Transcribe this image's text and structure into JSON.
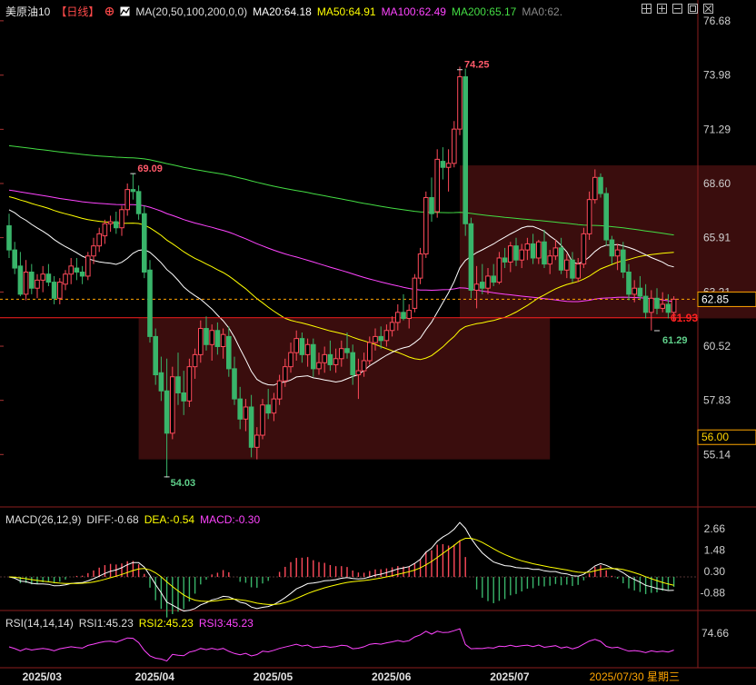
{
  "header": {
    "symbol": "美原油10",
    "period": "【日线】",
    "ma_title": "MA(20,50,100,200,0,0)",
    "ma20": "MA20:64.18",
    "ma50": "MA50:64.91",
    "ma100": "MA100:62.49",
    "ma200": "MA200:65.17",
    "ma0": "MA0:62.",
    "colors": {
      "ma20": "#ffffff",
      "ma50": "#ffff00",
      "ma100": "#ff44ff",
      "ma200": "#44dd44",
      "ma0": "#888888"
    }
  },
  "macd_header": {
    "title": "MACD(26,12,9)",
    "diff": "DIFF:-0.68",
    "dea": "DEA:-0.54",
    "macd": "MACD:-0.30"
  },
  "rsi_header": {
    "title": "RSI(14,14,14)",
    "rsi1": "RSI1:45.23",
    "rsi2": "RSI2:45.23",
    "rsi3": "RSI3:45.23"
  },
  "price_badges": {
    "current": "62.85",
    "ref_level": "56.00",
    "last": "61.93"
  },
  "annotations": {
    "high1": "69.09",
    "low1": "54.03",
    "high2": "74.25",
    "low2": "61.29"
  },
  "date_footer": "2025/07/30 星期三",
  "chart_data": [
    {
      "type": "candlestick",
      "ylim": [
        53.8,
        76.9
      ],
      "y_ticks": [
        "76.68",
        "73.98",
        "71.29",
        "68.60",
        "65.91",
        "63.21",
        "60.52",
        "57.83",
        "55.14"
      ],
      "x_ticks": [
        "2025/03",
        "2025/04",
        "2025/05",
        "2025/06",
        "2025/07"
      ],
      "reference_lines": {
        "current": 62.85,
        "last_close_line": 61.93
      },
      "boxes": [
        {
          "from_index": 23,
          "to_index": 96,
          "low": 54.9,
          "high": 61.9,
          "color": "#8b1e1e"
        },
        {
          "from_index": 80,
          "to_index": 146,
          "low": 61.9,
          "high": 69.5,
          "color": "#8b1e1e"
        }
      ],
      "ohlc": [
        [
          66.5,
          67.1,
          64.9,
          65.3
        ],
        [
          65.3,
          65.7,
          64.1,
          64.4
        ],
        [
          64.5,
          65.2,
          63.0,
          63.1
        ],
        [
          63.1,
          64.8,
          62.8,
          64.2
        ],
        [
          64.2,
          64.6,
          63.1,
          63.4
        ],
        [
          63.4,
          64.1,
          62.9,
          63.8
        ],
        [
          63.8,
          64.5,
          63.2,
          64.1
        ],
        [
          64.1,
          64.6,
          63.5,
          63.7
        ],
        [
          63.7,
          64.0,
          62.6,
          62.9
        ],
        [
          62.9,
          63.9,
          62.6,
          63.7
        ],
        [
          63.6,
          64.3,
          63.3,
          64.1
        ],
        [
          64.1,
          64.9,
          63.6,
          64.5
        ],
        [
          64.4,
          64.9,
          63.8,
          64.2
        ],
        [
          64.2,
          64.5,
          63.6,
          64.0
        ],
        [
          64.0,
          65.2,
          63.8,
          65.0
        ],
        [
          65.0,
          65.9,
          64.6,
          65.5
        ],
        [
          65.5,
          66.4,
          65.2,
          66.1
        ],
        [
          66.0,
          66.8,
          65.6,
          66.6
        ],
        [
          66.6,
          67.0,
          66.2,
          66.7
        ],
        [
          66.7,
          67.2,
          66.1,
          66.4
        ],
        [
          66.4,
          67.5,
          66.0,
          67.3
        ],
        [
          67.3,
          68.6,
          67.0,
          68.3
        ],
        [
          68.3,
          69.1,
          67.8,
          68.2
        ],
        [
          68.2,
          68.5,
          66.8,
          67.1
        ],
        [
          67.1,
          67.5,
          63.9,
          64.2
        ],
        [
          64.3,
          64.8,
          60.7,
          61.0
        ],
        [
          61.0,
          61.4,
          58.6,
          59.1
        ],
        [
          59.2,
          60.0,
          57.8,
          58.3
        ],
        [
          58.3,
          59.9,
          54.0,
          56.2
        ],
        [
          56.2,
          59.5,
          55.9,
          59.0
        ],
        [
          59.0,
          60.2,
          57.6,
          58.2
        ],
        [
          58.2,
          59.3,
          57.1,
          57.8
        ],
        [
          57.8,
          59.9,
          57.5,
          59.5
        ],
        [
          59.5,
          60.4,
          58.9,
          60.1
        ],
        [
          60.1,
          61.8,
          59.7,
          61.4
        ],
        [
          61.4,
          62.0,
          60.3,
          60.6
        ],
        [
          60.6,
          61.6,
          59.8,
          61.3
        ],
        [
          61.3,
          61.7,
          60.1,
          60.5
        ],
        [
          60.5,
          61.4,
          59.9,
          61.1
        ],
        [
          61.0,
          61.5,
          59.0,
          59.4
        ],
        [
          59.4,
          60.0,
          57.6,
          57.9
        ],
        [
          57.9,
          58.5,
          56.4,
          56.9
        ],
        [
          56.9,
          57.9,
          56.3,
          57.5
        ],
        [
          57.5,
          58.1,
          55.0,
          55.5
        ],
        [
          55.5,
          56.5,
          54.9,
          56.1
        ],
        [
          56.1,
          57.9,
          55.9,
          57.6
        ],
        [
          57.6,
          58.4,
          56.9,
          57.2
        ],
        [
          57.2,
          58.2,
          56.8,
          57.9
        ],
        [
          57.9,
          59.1,
          57.6,
          58.8
        ],
        [
          58.8,
          59.9,
          58.5,
          59.5
        ],
        [
          59.5,
          60.7,
          59.2,
          60.2
        ],
        [
          60.2,
          61.3,
          59.8,
          60.9
        ],
        [
          60.9,
          61.2,
          59.7,
          60.1
        ],
        [
          60.1,
          60.9,
          59.5,
          60.6
        ],
        [
          60.6,
          60.9,
          59.0,
          59.4
        ],
        [
          59.4,
          60.2,
          59.1,
          59.7
        ],
        [
          59.7,
          60.5,
          59.2,
          60.1
        ],
        [
          60.1,
          60.8,
          59.3,
          59.6
        ],
        [
          59.6,
          60.4,
          59.2,
          59.9
        ],
        [
          59.9,
          60.8,
          59.5,
          60.4
        ],
        [
          60.4,
          61.2,
          59.9,
          60.2
        ],
        [
          60.2,
          60.6,
          58.6,
          59.1
        ],
        [
          59.1,
          59.9,
          57.9,
          59.3
        ],
        [
          59.3,
          60.2,
          59.0,
          59.8
        ],
        [
          59.8,
          61.0,
          59.6,
          60.7
        ],
        [
          60.7,
          61.4,
          60.3,
          61.0
        ],
        [
          61.0,
          61.5,
          60.4,
          60.8
        ],
        [
          60.8,
          61.6,
          60.5,
          61.3
        ],
        [
          61.3,
          62.0,
          61.0,
          61.7
        ],
        [
          61.7,
          62.6,
          61.3,
          62.2
        ],
        [
          62.2,
          63.1,
          61.8,
          61.9
        ],
        [
          61.9,
          62.6,
          61.4,
          62.3
        ],
        [
          62.4,
          64.1,
          62.2,
          63.9
        ],
        [
          63.9,
          65.4,
          63.6,
          65.1
        ],
        [
          65.1,
          68.2,
          64.9,
          67.9
        ],
        [
          67.9,
          68.9,
          66.7,
          67.1
        ],
        [
          67.2,
          70.3,
          66.9,
          69.8
        ],
        [
          69.7,
          70.4,
          68.8,
          69.4
        ],
        [
          69.4,
          70.3,
          68.2,
          69.6
        ],
        [
          69.6,
          71.7,
          69.4,
          71.3
        ],
        [
          71.3,
          74.4,
          71.0,
          73.9
        ],
        [
          73.9,
          74.3,
          66.0,
          66.6
        ],
        [
          66.6,
          66.9,
          62.9,
          63.3
        ],
        [
          63.3,
          64.5,
          62.4,
          63.6
        ],
        [
          63.7,
          64.6,
          63.1,
          63.4
        ],
        [
          63.4,
          64.4,
          63.1,
          64.0
        ],
        [
          64.0,
          64.6,
          63.5,
          63.7
        ],
        [
          63.7,
          65.2,
          63.6,
          64.9
        ],
        [
          64.9,
          65.4,
          64.4,
          64.7
        ],
        [
          64.7,
          65.7,
          64.2,
          65.5
        ],
        [
          65.5,
          65.9,
          64.5,
          64.8
        ],
        [
          64.8,
          65.6,
          64.4,
          65.3
        ],
        [
          65.3,
          65.9,
          64.8,
          65.6
        ],
        [
          65.6,
          66.1,
          64.6,
          64.9
        ],
        [
          64.9,
          65.8,
          64.6,
          65.7
        ],
        [
          65.7,
          66.3,
          64.4,
          64.6
        ],
        [
          64.6,
          65.3,
          64.1,
          65.0
        ],
        [
          65.0,
          65.8,
          64.8,
          65.4
        ],
        [
          65.4,
          65.9,
          64.1,
          64.3
        ],
        [
          64.3,
          65.1,
          63.9,
          64.8
        ],
        [
          64.8,
          65.2,
          63.7,
          63.9
        ],
        [
          63.9,
          64.9,
          63.7,
          64.6
        ],
        [
          64.6,
          66.4,
          64.4,
          66.1
        ],
        [
          66.1,
          68.2,
          65.8,
          67.8
        ],
        [
          67.8,
          69.3,
          67.6,
          68.9
        ],
        [
          68.9,
          69.1,
          67.9,
          68.1
        ],
        [
          68.1,
          68.4,
          65.5,
          65.8
        ],
        [
          65.8,
          66.0,
          64.6,
          65.0
        ],
        [
          65.0,
          65.6,
          64.3,
          65.3
        ],
        [
          65.3,
          65.7,
          63.9,
          64.2
        ],
        [
          64.2,
          64.6,
          62.8,
          63.1
        ],
        [
          63.1,
          63.8,
          62.7,
          63.4
        ],
        [
          63.4,
          64.0,
          62.8,
          63.0
        ],
        [
          63.0,
          63.6,
          61.9,
          62.2
        ],
        [
          62.2,
          63.3,
          61.3,
          62.9
        ],
        [
          62.9,
          63.4,
          62.1,
          62.4
        ],
        [
          62.4,
          63.2,
          62.2,
          62.6
        ],
        [
          62.6,
          63.1,
          61.9,
          62.2
        ],
        [
          62.2,
          63.0,
          61.8,
          62.85
        ]
      ]
    },
    {
      "type": "macd",
      "y_ticks": [
        "2.66",
        "1.48",
        "0.30",
        "-0.88"
      ],
      "ylim": [
        -1.5,
        3.0
      ],
      "diff_color": "#ffffff",
      "dea_color": "#ffff00"
    },
    {
      "type": "rsi",
      "y_ticks": [
        "74.66"
      ],
      "ylim": [
        20,
        90
      ],
      "line_color": "#ff44ff"
    }
  ]
}
